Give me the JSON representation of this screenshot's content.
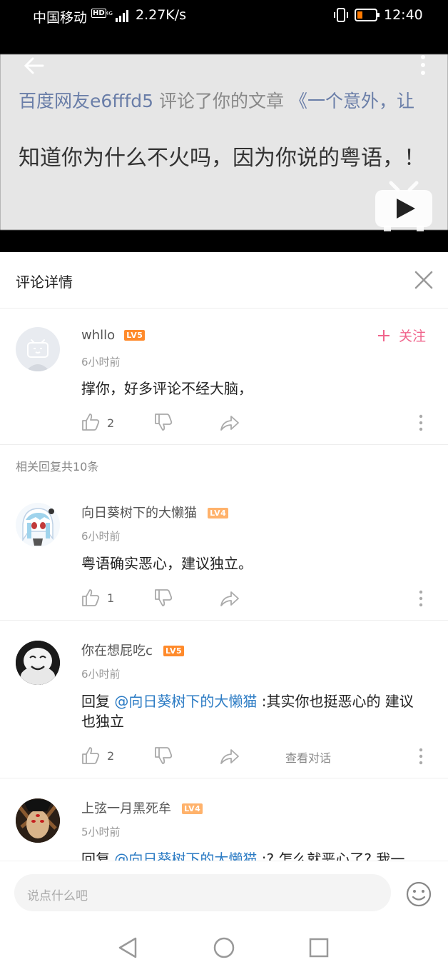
{
  "status_bar": {
    "carrier": "中国移动",
    "hd": "HD",
    "speed": "2.27K/s",
    "time": "12:40",
    "battery_color": "#ff7a00"
  },
  "video": {
    "line1_user": "百度网友e6fffd5",
    "line1_action": "评论了你的文章",
    "line1_article": "《一个意外，让",
    "line2_text": "知道你为什么不火吗，因为你说的粤语，！"
  },
  "header": {
    "title": "评论详情"
  },
  "main_comment": {
    "username": "whllo",
    "level": "LV5",
    "follow_label": "关注",
    "time": "6小时前",
    "content": "撑你，好多评论不经大脑，",
    "likes": "2"
  },
  "replies_summary": "相关回复共10条",
  "replies": [
    {
      "username": "向日葵树下的大懒猫",
      "level": "LV4",
      "time": "6小时前",
      "content": "粤语确实恶心，建议独立。",
      "likes": "1"
    },
    {
      "username": "你在想屁吃c",
      "level": "LV5",
      "time": "6小时前",
      "reply_prefix": "回复",
      "mention": "@向日葵树下的大懒猫",
      "content_line1": " :其实你也挺恶心的 建议",
      "content_line2": "也独立",
      "likes": "2",
      "view_conversation": "查看对话"
    },
    {
      "username": "上弦一月黑死牟",
      "level": "LV4",
      "time": "5小时前",
      "reply_prefix": "回复",
      "mention": "@向日葵树下的大懒猫",
      "content_line1": " :? 怎么就恶心了? 我一"
    }
  ],
  "input": {
    "placeholder": "说点什么吧"
  },
  "colors": {
    "accent_pink": "#f0648c",
    "link_blue": "#2b7bc4",
    "level5": "#ff8a2b",
    "level4": "#ffb26b"
  }
}
